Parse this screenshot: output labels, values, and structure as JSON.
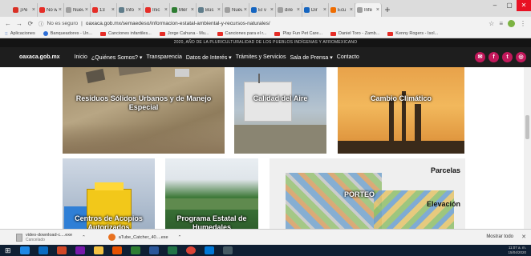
{
  "browser": {
    "tabs": [
      {
        "label": "¡Pe",
        "color": "#d93025"
      },
      {
        "label": "No w",
        "color": "#e52d27"
      },
      {
        "label": "Nuev",
        "color": "#9e9e9e"
      },
      {
        "label": "13",
        "color": "#e52d27"
      },
      {
        "label": "Info",
        "color": "#607d8b"
      },
      {
        "label": "Inic",
        "color": "#e52d27"
      },
      {
        "label": "Mér",
        "color": "#2e7d32"
      },
      {
        "label": "Bús",
        "color": "#607d8b"
      },
      {
        "label": "Nuev",
        "color": "#9e9e9e"
      },
      {
        "label": "El v",
        "color": "#1565c0"
      },
      {
        "label": "dire",
        "color": "#9e9e9e"
      },
      {
        "label": "Dir",
        "color": "#1565c0"
      },
      {
        "label": "Ecu",
        "color": "#ef6c00"
      },
      {
        "label": "Infe",
        "color": "#9e9e9e"
      }
    ],
    "new_tab": "+",
    "address": {
      "security": "No es seguro",
      "url": "oaxaca.gob.mx/semaedeso/informacion-estatal-ambiental-y-recursos-naturales/"
    },
    "bookmarks": [
      {
        "label": "Aplicaciones",
        "icon": "apps-icon"
      },
      {
        "label": "Banqueadores - Un...",
        "icon": "link-icon"
      },
      {
        "label": "Canciones infantiles...",
        "icon": "youtube-icon"
      },
      {
        "label": "Jorge Cahuna - Mu...",
        "icon": "youtube-icon"
      },
      {
        "label": "Canciones para el r...",
        "icon": "youtube-icon"
      },
      {
        "label": "Play Fun Pet Care...",
        "icon": "youtube-icon"
      },
      {
        "label": "Daniel Toro - Zamb...",
        "icon": "youtube-icon"
      },
      {
        "label": "Kenny Rogers - Isol...",
        "icon": "youtube-icon"
      }
    ]
  },
  "site": {
    "announcement": "2020, AÑO DE LA PLURICULTURALIDAD DE LOS PUEBLOS INDÍGENAS Y AFROMEXICANO",
    "logo": "oaxaca.gob.mx",
    "menu": [
      "Inicio",
      "¿Quiénes Somos? ▾",
      "Transparencia",
      "Datos de Interés ▾",
      "Trámites y Servicios",
      "Sala de Prensa ▾",
      "Contacto"
    ],
    "social": [
      {
        "name": "mail-icon",
        "glyph": "✉"
      },
      {
        "name": "facebook-icon",
        "glyph": "f"
      },
      {
        "name": "twitter-icon",
        "glyph": "t"
      },
      {
        "name": "instagram-icon",
        "glyph": "◎"
      }
    ],
    "cards": [
      {
        "title": "Residuos Sólidos Urbanos y de Manejo Especial"
      },
      {
        "title": "Calidad del Aire"
      },
      {
        "title": "Cambio Climático"
      },
      {
        "title": "Centros de Acopios Autorizados"
      },
      {
        "title": "Programa Estatal de Humedales"
      },
      {
        "title": "PORTEO",
        "labels": [
          "Parcelas",
          "Elevación"
        ]
      }
    ]
  },
  "downloads": {
    "items": [
      {
        "name": "video-download-c....exe",
        "status": "Cancelado"
      },
      {
        "name": "aTube_Catcher_40....exe",
        "status": ""
      }
    ],
    "show_all": "Mostrar todo"
  },
  "taskbar": {
    "time": "11:07 a. m.",
    "date": "15/04/2020"
  }
}
